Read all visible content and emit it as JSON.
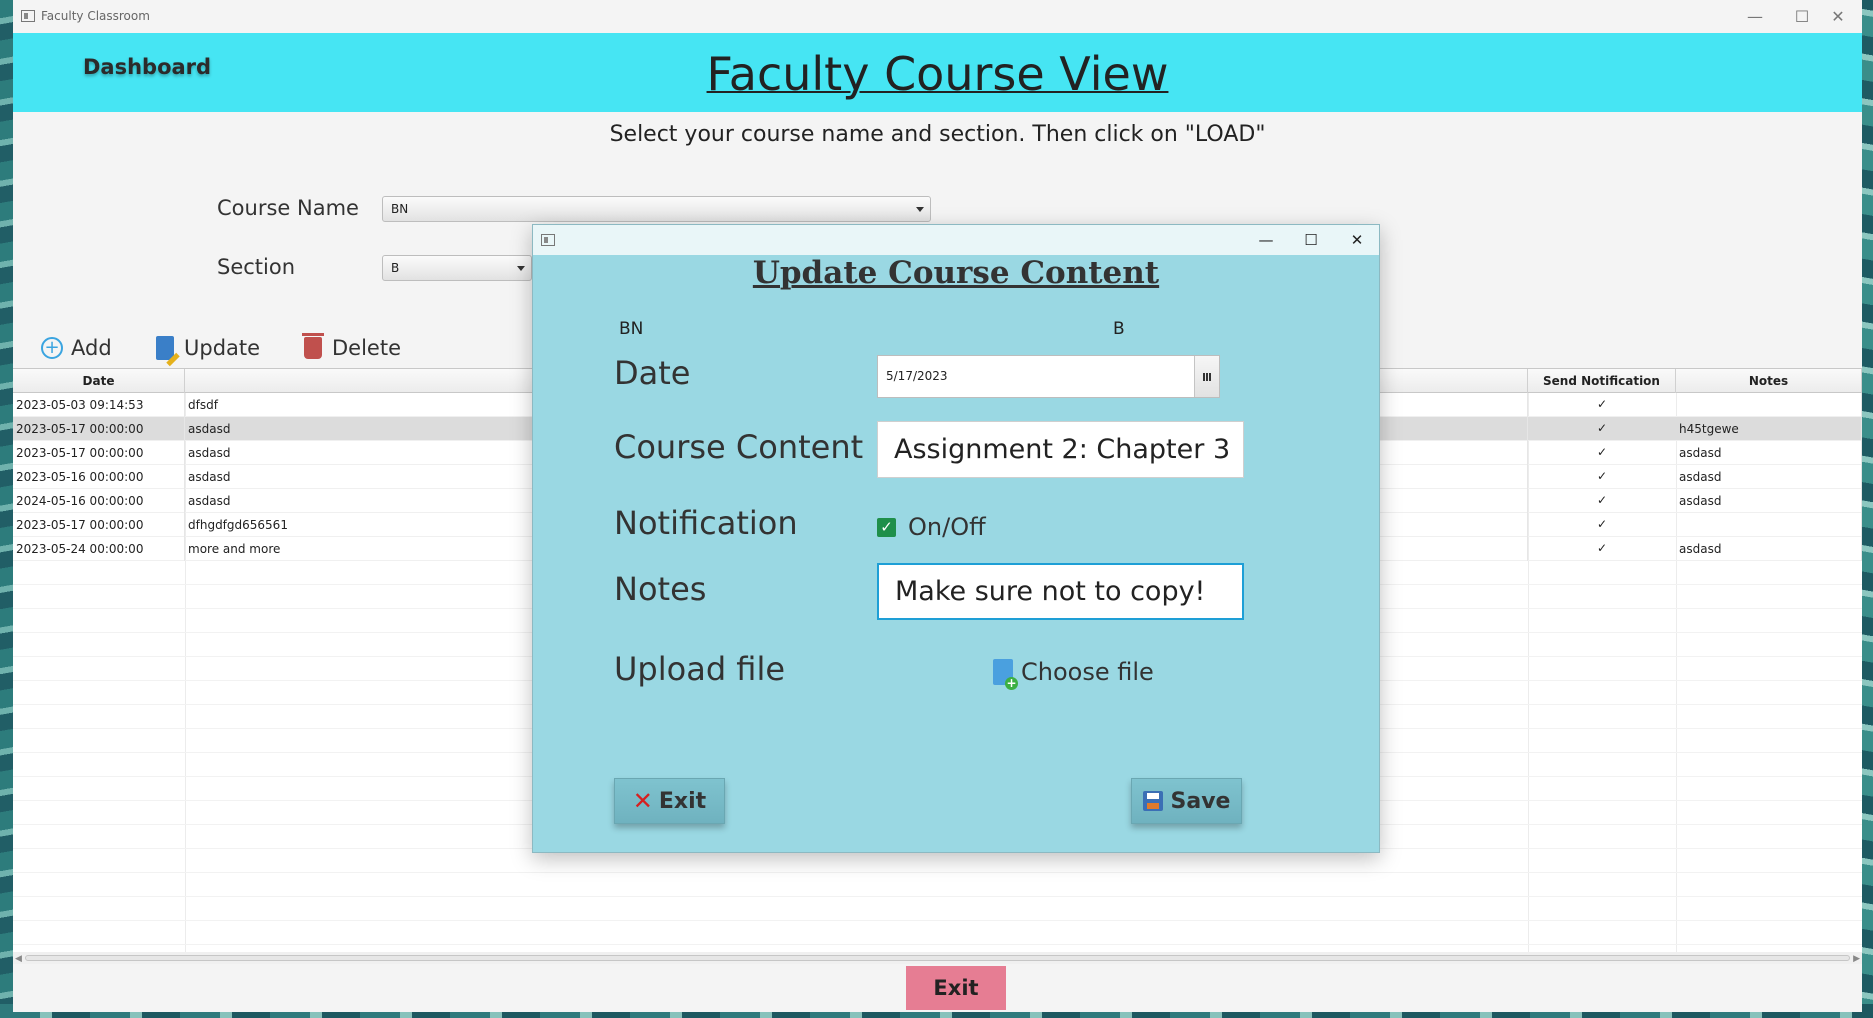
{
  "window": {
    "title": "Faculty Classroom",
    "controls": {
      "minimize": "—",
      "maximize": "☐",
      "close": "✕"
    }
  },
  "header": {
    "dashboard_label": "Dashboard",
    "page_title": "Faculty Course View",
    "background_color": "#46e5f3"
  },
  "instruction": "Select your course name and section. Then click on \"LOAD\"",
  "form": {
    "course_name_label": "Course Name",
    "course_name_value": "BN",
    "section_label": "Section",
    "section_value": "B"
  },
  "toolbar": {
    "add_label": "Add",
    "update_label": "Update",
    "delete_label": "Delete"
  },
  "table": {
    "columns": {
      "date": "Date",
      "send_notification": "Send Notification",
      "notes": "Notes"
    },
    "rows": [
      {
        "date": "2023-05-03 09:14:53",
        "content": "dfsdf",
        "notify": true,
        "notes": ""
      },
      {
        "date": "2023-05-17 00:00:00",
        "content": "asdasd",
        "notify": true,
        "notes": "h45tgewe",
        "selected": true
      },
      {
        "date": "2023-05-17 00:00:00",
        "content": "asdasd",
        "notify": true,
        "notes": "asdasd"
      },
      {
        "date": "2023-05-16 00:00:00",
        "content": "asdasd",
        "notify": true,
        "notes": "asdasd"
      },
      {
        "date": "2024-05-16 00:00:00",
        "content": "asdasd",
        "notify": true,
        "notes": "asdasd"
      },
      {
        "date": "2023-05-17 00:00:00",
        "content": "dfhgdfgd656561",
        "notify": true,
        "notes": ""
      },
      {
        "date": "2023-05-24 00:00:00",
        "content": "more and more",
        "notify": true,
        "notes": "asdasd"
      }
    ]
  },
  "main_exit_label": "Exit",
  "dialog": {
    "title": "Update Course Content",
    "course": "BN",
    "section": "B",
    "date_label": "Date",
    "date_value": "5/17/2023",
    "content_label": "Course Content",
    "content_value": "Assignment 2: Chapter 3",
    "notification_label": "Notification",
    "notification_toggle_label": "On/Off",
    "notification_checked": true,
    "notes_label": "Notes",
    "notes_value": "Make sure not to copy!",
    "upload_label": "Upload file",
    "choose_file_label": "Choose file",
    "exit_label": "Exit",
    "save_label": "Save",
    "background_color": "#9ad8e3"
  }
}
